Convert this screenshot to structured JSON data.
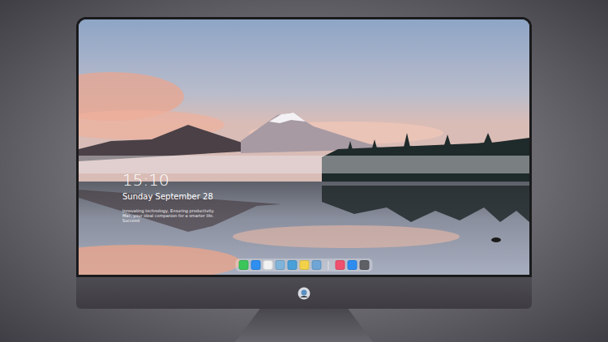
{
  "lock_screen": {
    "time": "15:10",
    "date": "Sunday September 28",
    "tagline": "Innovating technology, Ensuring productivity. Mac, your ideal companion for a smarter life. Succeed"
  },
  "dock": {
    "pinned": [
      {
        "color": "#3cc65a"
      },
      {
        "color": "#2f8ff0"
      },
      {
        "color": "#f2f2f2"
      },
      {
        "color": "#7fb3d9"
      },
      {
        "color": "#4aa0d8"
      },
      {
        "color": "#f3d24a"
      },
      {
        "color": "#6fa6d6"
      }
    ],
    "others": [
      {
        "color": "#f0506e"
      },
      {
        "color": "#2d8cf0"
      },
      {
        "color": "#5f5f66"
      }
    ]
  }
}
